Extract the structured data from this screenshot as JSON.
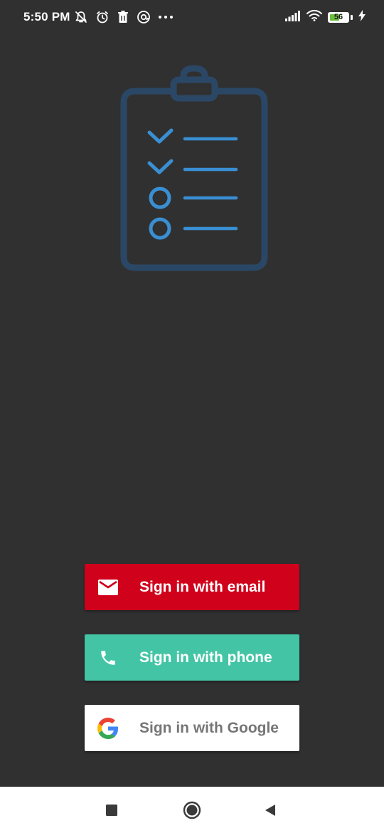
{
  "status_bar": {
    "time": "5:50 PM",
    "battery_level": "56",
    "battery_percent": 56,
    "charging": true,
    "left_icons": [
      "notifications-off-icon",
      "alarm-icon",
      "trash-icon",
      "at-icon",
      "more-dots-icon"
    ],
    "right_icons": [
      "signal-icon",
      "wifi-icon",
      "battery-icon",
      "charging-bolt-icon"
    ]
  },
  "illustration": {
    "icon": "clipboard-checklist-icon",
    "items": [
      {
        "state": "checked"
      },
      {
        "state": "checked"
      },
      {
        "state": "unchecked"
      },
      {
        "state": "unchecked"
      }
    ],
    "colors": {
      "outline": "#2b4766",
      "marks": "#3a8fd3"
    }
  },
  "auth": {
    "email_label": "Sign in with email",
    "phone_label": "Sign in with phone",
    "google_label": "Sign in with Google",
    "colors": {
      "email": "#d0021b",
      "phone": "#43c5a5",
      "google": "#ffffff"
    }
  },
  "nav_bar": {
    "buttons": [
      "recents-square-icon",
      "home-circle-icon",
      "back-triangle-icon"
    ]
  }
}
